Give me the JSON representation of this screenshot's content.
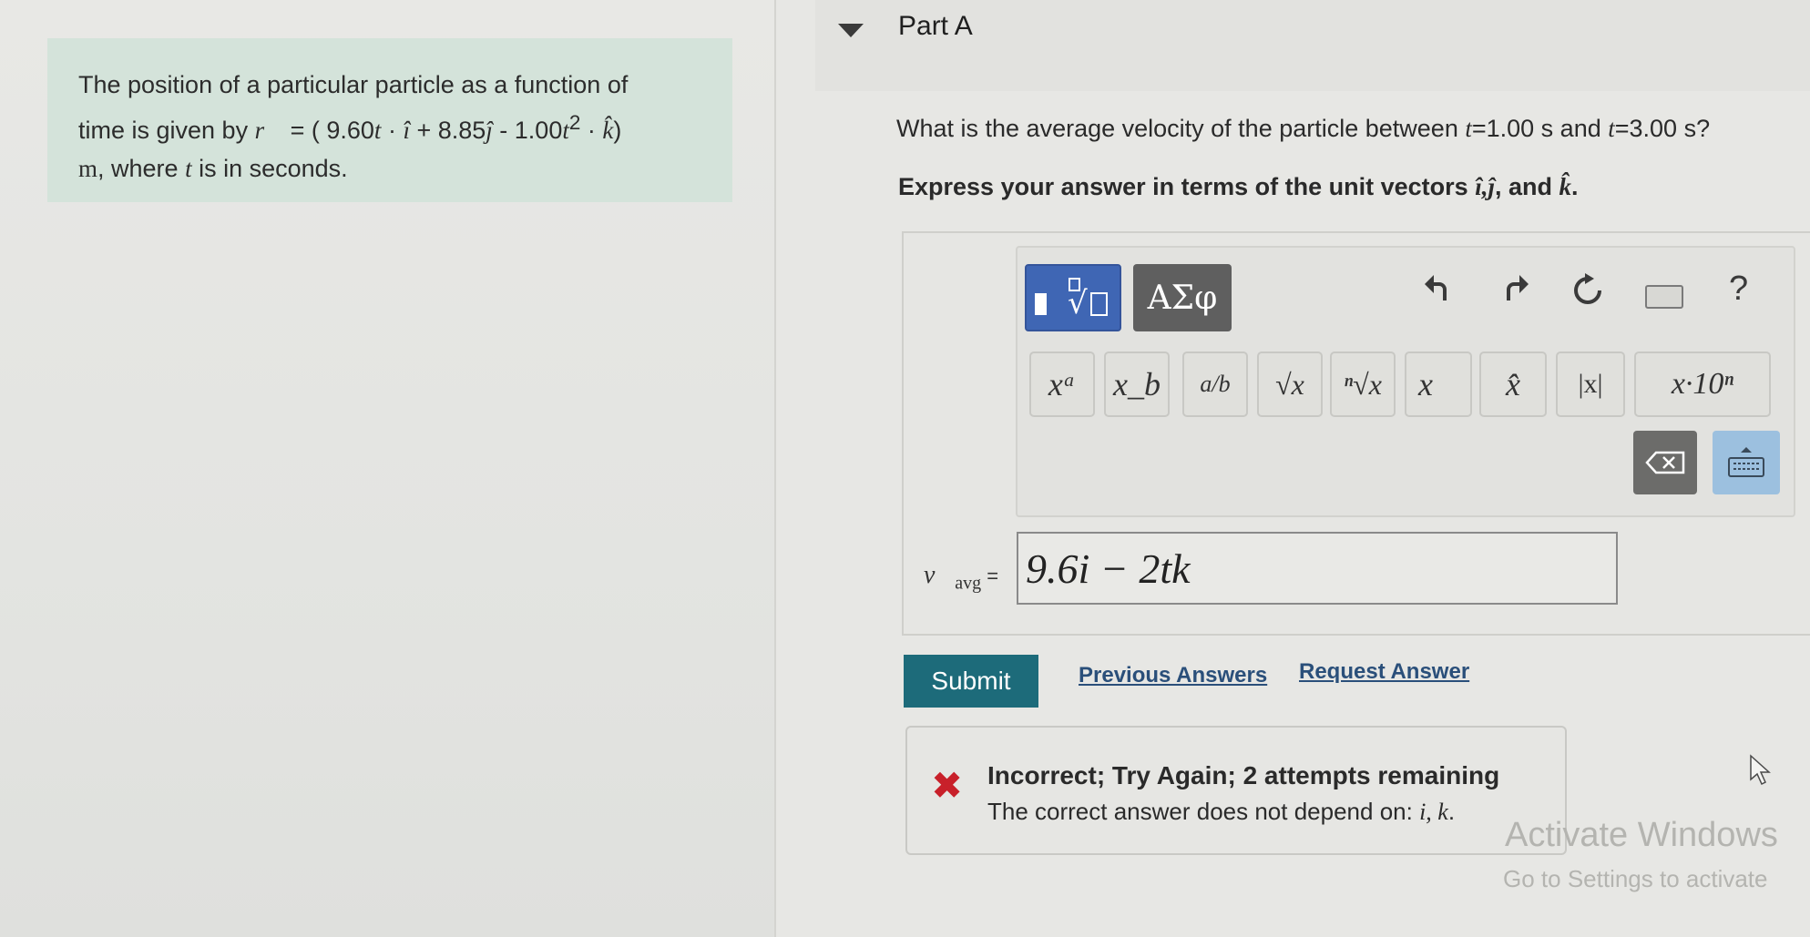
{
  "problem": {
    "line1": "The position of a particular particle as a function of",
    "line2_prefix": "time is given by ",
    "r_vec": "r⃗",
    "equals": " = ( 9.60",
    "t1": "t",
    "dot1": " · ",
    "ihat": "î",
    "plus": " + 8.85",
    "jhat": "ĵ",
    "minus": " - 1.00",
    "t2": "t",
    "sq": "2",
    "dot2": " · ",
    "khat": "k̂",
    "close": ")",
    "line3_m": "m",
    "line3_mid": ", where ",
    "line3_t": "t",
    "line3_end": " is in seconds."
  },
  "part": {
    "title": "Part A",
    "question_prefix": "What is the average velocity of the particle between ",
    "q_t1": "t",
    "q_eq1": "=1.00 s and ",
    "q_t2": "t",
    "q_eq2": "=3.00 s?",
    "express_prefix": "Express your answer in terms of the unit vectors ",
    "express_vectors": "î,ĵ",
    "express_and": ", and ",
    "express_k": "k̂",
    "express_end": "."
  },
  "toolbar": {
    "greek_label": "ΑΣφ",
    "help_label": "?",
    "symbols": [
      "xᵃ",
      "x_b",
      "a/b",
      "√x",
      "ⁿ√x",
      "x⃗",
      "x̂",
      "|x|",
      "x·10ⁿ"
    ]
  },
  "answer": {
    "label_v": "v⃗",
    "label_sub": "avg",
    "label_eq": " =",
    "value": "9.6i − 2tk"
  },
  "actions": {
    "submit": "Submit",
    "previous": "Previous Answers",
    "request": "Request Answer"
  },
  "feedback": {
    "icon": "✖",
    "title": "Incorrect; Try Again; 2 attempts remaining",
    "text_prefix": "The correct answer does not depend on: ",
    "text_vars": "i, k",
    "text_end": "."
  },
  "watermark": {
    "title": "Activate Windows",
    "subtitle": "Go to Settings to activate"
  },
  "colors": {
    "problem_bg": "#d4e3da",
    "submit_bg": "#1d6b7a",
    "template_btn": "#3f66b4",
    "error_red": "#c8202a"
  }
}
